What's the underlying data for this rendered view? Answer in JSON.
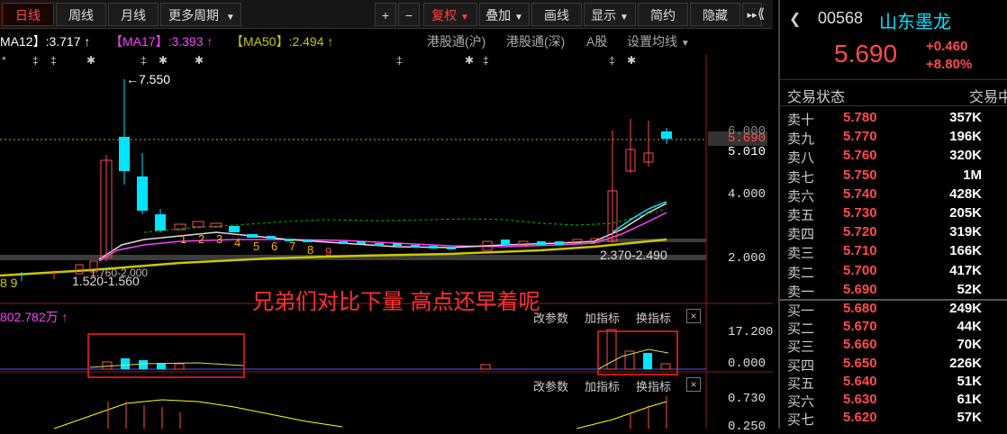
{
  "toolbar": {
    "period_tabs": [
      "日线",
      "周线",
      "月线",
      "更多周期"
    ],
    "plus": "+",
    "minus": "−",
    "fuquan": "复权",
    "buttons": [
      "叠加",
      "画线",
      "显示",
      "简约",
      "隐藏"
    ],
    "expand": "▸▸",
    "collapse": "⟪"
  },
  "ma": {
    "ma12": "MA12】:3.717 ↑",
    "ma17": "【MA17】:3.393 ↑",
    "ma50": "【MA50】:2.494 ↑"
  },
  "tabs_right": [
    "港股通(沪)",
    "港股通(深)",
    "A股",
    "设置均线"
  ],
  "chart_labels": {
    "high": "←7.550",
    "low_left": "1.520-1.560",
    "low_left2": "1.760-2.000",
    "low_right": "2.370-2.490",
    "y_axis": [
      "6.000",
      "5.690",
      "5.010",
      "4.000",
      "2.000"
    ],
    "count_left": "8  9",
    "seq": [
      "1",
      "2",
      "3",
      "4",
      "5",
      "6",
      "7",
      "8",
      "9"
    ]
  },
  "annotation": "兄弟们对比下量  高点还早着呢",
  "volume": {
    "label": "802.782万 ↑",
    "y_axis": [
      "17.200",
      "0.000"
    ],
    "btn_params": "改参数",
    "btn_add": "加指标",
    "btn_switch": "换指标",
    "close": "×"
  },
  "indicator2": {
    "y_axis": [
      "0.730",
      "0.250"
    ],
    "btn_params": "改参数",
    "btn_add": "加指标",
    "btn_switch": "换指标",
    "close": "×"
  },
  "quote": {
    "code": "00568",
    "name": "山东墨龙",
    "price": "5.690",
    "change": "+0.460",
    "change_pct": "+8.80%",
    "status_label": "交易状态",
    "status_right": "交易中",
    "asks": [
      {
        "label": "卖十",
        "price": "5.780",
        "vol": "357K"
      },
      {
        "label": "卖九",
        "price": "5.770",
        "vol": "196K"
      },
      {
        "label": "卖八",
        "price": "5.760",
        "vol": "320K"
      },
      {
        "label": "卖七",
        "price": "5.750",
        "vol": "1M"
      },
      {
        "label": "卖六",
        "price": "5.740",
        "vol": "428K"
      },
      {
        "label": "卖五",
        "price": "5.730",
        "vol": "205K"
      },
      {
        "label": "卖四",
        "price": "5.720",
        "vol": "319K"
      },
      {
        "label": "卖三",
        "price": "5.710",
        "vol": "166K"
      },
      {
        "label": "卖二",
        "price": "5.700",
        "vol": "417K"
      },
      {
        "label": "卖一",
        "price": "5.690",
        "vol": "52K"
      }
    ],
    "bids": [
      {
        "label": "买一",
        "price": "5.680",
        "vol": "249K"
      },
      {
        "label": "买二",
        "price": "5.670",
        "vol": "44K"
      },
      {
        "label": "买三",
        "price": "5.660",
        "vol": "70K"
      },
      {
        "label": "买四",
        "price": "5.650",
        "vol": "226K"
      },
      {
        "label": "买五",
        "price": "5.640",
        "vol": "51K"
      },
      {
        "label": "买六",
        "price": "5.630",
        "vol": "61K"
      },
      {
        "label": "买七",
        "price": "5.620",
        "vol": "57K"
      }
    ]
  },
  "colors": {
    "up": "#ff4b4b",
    "down": "#00e5ff",
    "ma12": "#ffffff",
    "ma17": "#ff40ff",
    "ma50": "#c8c800",
    "accent": "#00e5ff"
  }
}
